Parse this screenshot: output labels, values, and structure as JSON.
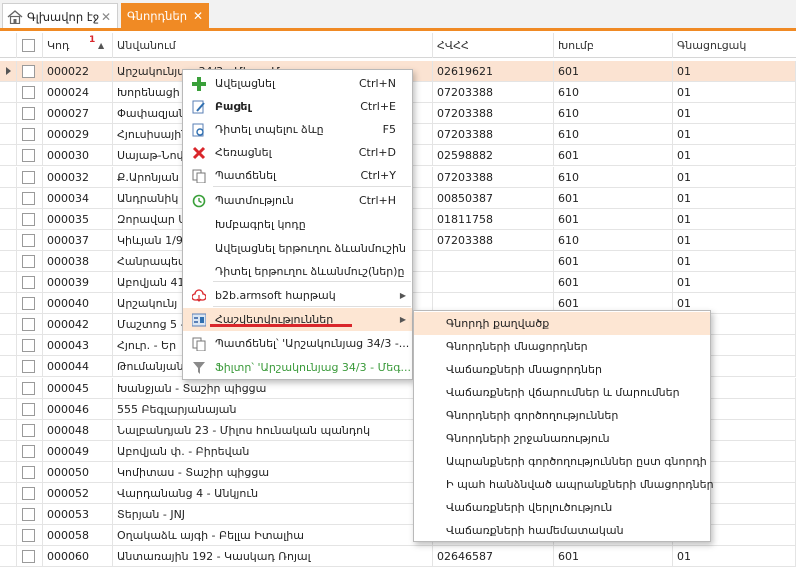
{
  "tabs": [
    {
      "label": "Գլխավոր էջ"
    },
    {
      "label": "Գնորդներ"
    }
  ],
  "columns": {
    "code": "Կոդ",
    "sort_order": "1",
    "name": "Անվանում",
    "tin": "ՀՎՀՀ",
    "group": "Խումբ",
    "price_type": "Գնացուցակ"
  },
  "rows": [
    {
      "code": "000022",
      "name": "Արշակունյաց 34/3 - Մեգա Մոլ",
      "tin": "02619621",
      "group": "601",
      "price": "01"
    },
    {
      "code": "000024",
      "name": "Խորենացի",
      "tin": "07203388",
      "group": "610",
      "price": "01"
    },
    {
      "code": "000027",
      "name": "Փափազյան",
      "tin": "07203388",
      "group": "610",
      "price": "01"
    },
    {
      "code": "000029",
      "name": "Հյուսիսային",
      "tin": "07203388",
      "group": "610",
      "price": "01"
    },
    {
      "code": "000030",
      "name": "Սայաթ-Նովա",
      "tin": "02598882",
      "group": "601",
      "price": "01"
    },
    {
      "code": "000032",
      "name": "Ք.Արոնյան",
      "tin": "07203388",
      "group": "610",
      "price": "01"
    },
    {
      "code": "000034",
      "name": "Անդրանիկ 3",
      "tin": "00850387",
      "group": "601",
      "price": "01"
    },
    {
      "code": "000035",
      "name": "Զորավար Ա",
      "tin": "01811758",
      "group": "601",
      "price": "01"
    },
    {
      "code": "000037",
      "name": "Կիևյան 1/9",
      "tin": "07203388",
      "group": "610",
      "price": "01"
    },
    {
      "code": "000038",
      "name": "Հանրապետ",
      "tin": "",
      "group": "601",
      "price": "01"
    },
    {
      "code": "000039",
      "name": "Աբովյան 41",
      "tin": "",
      "group": "601",
      "price": "01"
    },
    {
      "code": "000040",
      "name": "Արշակունյ",
      "tin": "",
      "group": "601",
      "price": "01"
    },
    {
      "code": "000042",
      "name": "Մաշտոց 5 -",
      "tin": "",
      "group": "",
      "price": ""
    },
    {
      "code": "000043",
      "name": "Հյուր. - Եր",
      "tin": "",
      "group": "",
      "price": ""
    },
    {
      "code": "000044",
      "name": "Թումանյան",
      "tin": "",
      "group": "",
      "price": ""
    },
    {
      "code": "000045",
      "name": "Խանջյան - Տաշիր պիցցա",
      "tin": "",
      "group": "",
      "price": ""
    },
    {
      "code": "000046",
      "name": "555 Բեգլարյանայան",
      "tin": "",
      "group": "",
      "price": ""
    },
    {
      "code": "000048",
      "name": "Նալբանդյան 23 - Միլոս հունական պանդոկ",
      "tin": "",
      "group": "",
      "price": ""
    },
    {
      "code": "000049",
      "name": "Աբովյան փ. - Բիրեվան",
      "tin": "",
      "group": "",
      "price": ""
    },
    {
      "code": "000050",
      "name": "Կոմիտաս - Տաշիր պիցցա",
      "tin": "",
      "group": "",
      "price": ""
    },
    {
      "code": "000052",
      "name": "Վարդանանց 4 - Անկյուն",
      "tin": "",
      "group": "",
      "price": ""
    },
    {
      "code": "000053",
      "name": "Տերյան - JNJ",
      "tin": "",
      "group": "",
      "price": ""
    },
    {
      "code": "000058",
      "name": "Օղակաձև այգի - Բելլա Իտալիա",
      "tin": "",
      "group": "",
      "price": ""
    },
    {
      "code": "000060",
      "name": "Անտառային 192 - Կասկադ Ռոյալ",
      "tin": "02646587",
      "group": "601",
      "price": "01"
    }
  ],
  "context_menu": {
    "items": [
      {
        "label": "Ավելացնել",
        "shortcut": "Ctrl+N",
        "icon": "plus-icon"
      },
      {
        "label": "Բացել",
        "shortcut": "Ctrl+E",
        "icon": "edit-icon"
      },
      {
        "label": "Դիտել տպելու ձևը",
        "shortcut": "F5",
        "icon": "preview-icon"
      },
      {
        "label": "Հեռացնել",
        "shortcut": "Ctrl+D",
        "icon": "delete-icon"
      },
      {
        "label": "Պատճենել",
        "shortcut": "Ctrl+Y",
        "icon": "copy-icon"
      },
      {
        "label": "Պատմություն",
        "shortcut": "Ctrl+H",
        "icon": "history-icon"
      },
      {
        "label": "Խմբագրել կոդը",
        "shortcut": "",
        "icon": ""
      },
      {
        "label": "Ավելացնել երթուղու ձևանմուշին",
        "shortcut": "",
        "icon": ""
      },
      {
        "label": "Դիտել երթուղու ձևանմուշ(ներ)ը",
        "shortcut": "",
        "icon": ""
      },
      {
        "label": "b2b.armsoft հարթակ",
        "shortcut": "",
        "icon": "cloud-icon"
      },
      {
        "label": "Հաշվետվություններ",
        "shortcut": "",
        "icon": "report-icon"
      },
      {
        "label": "Պատճենել՝ 'Արշակունյաց 34/3 -...",
        "shortcut": "",
        "icon": "copy-icon"
      },
      {
        "label": "Ֆիլտր՝ 'Արշակունյաց 34/3 - Մեգ...",
        "shortcut": "",
        "icon": "filter-icon"
      }
    ]
  },
  "submenu": {
    "items": [
      "Գնորդի քաղվածք",
      "Գնորդների մնացորդներ",
      "Վաճառքների մնացորդներ",
      "Վաճառքների վճարումներ և մարումներ",
      "Գնորդների գործողություններ",
      "Գնորդների շրջանառություն",
      "Ապրանքների գործողություններ ըստ գնորդի",
      "Ի պահ հանձնված ապրանքների մնացորդներ",
      "Վաճառքների վերլուծություն",
      "Վաճառքների համեմատական"
    ]
  },
  "colors": {
    "accent": "#f08a24",
    "selected_row": "#fbe3d2",
    "menu_highlight": "#fde6d3",
    "marker": "#d9262b"
  }
}
